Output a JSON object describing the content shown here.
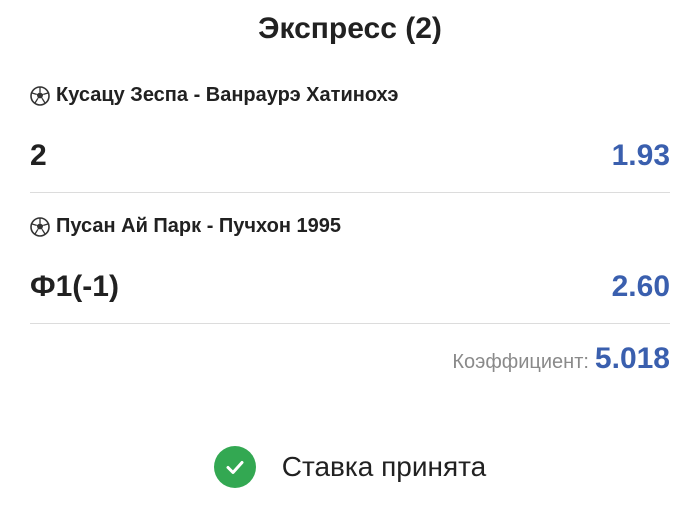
{
  "title": "Экспресс (2)",
  "bets": [
    {
      "match": "Кусацу Зеспа - Ванраурэ Хатинохэ",
      "outcome": "2",
      "odds": "1.93",
      "sport_icon": "soccer-ball-icon"
    },
    {
      "match": "Пусан Ай Парк - Пучхон 1995",
      "outcome": "Ф1(-1)",
      "odds": "2.60",
      "sport_icon": "soccer-ball-icon"
    }
  ],
  "total": {
    "label": "Коэффициент:",
    "value": "5.018"
  },
  "status": {
    "text": "Ставка принята",
    "icon": "check-circle-icon"
  },
  "colors": {
    "odds": "#3a5fae",
    "success": "#33a852",
    "divider": "#dcdcdc",
    "muted_text": "#8a8a8a"
  }
}
